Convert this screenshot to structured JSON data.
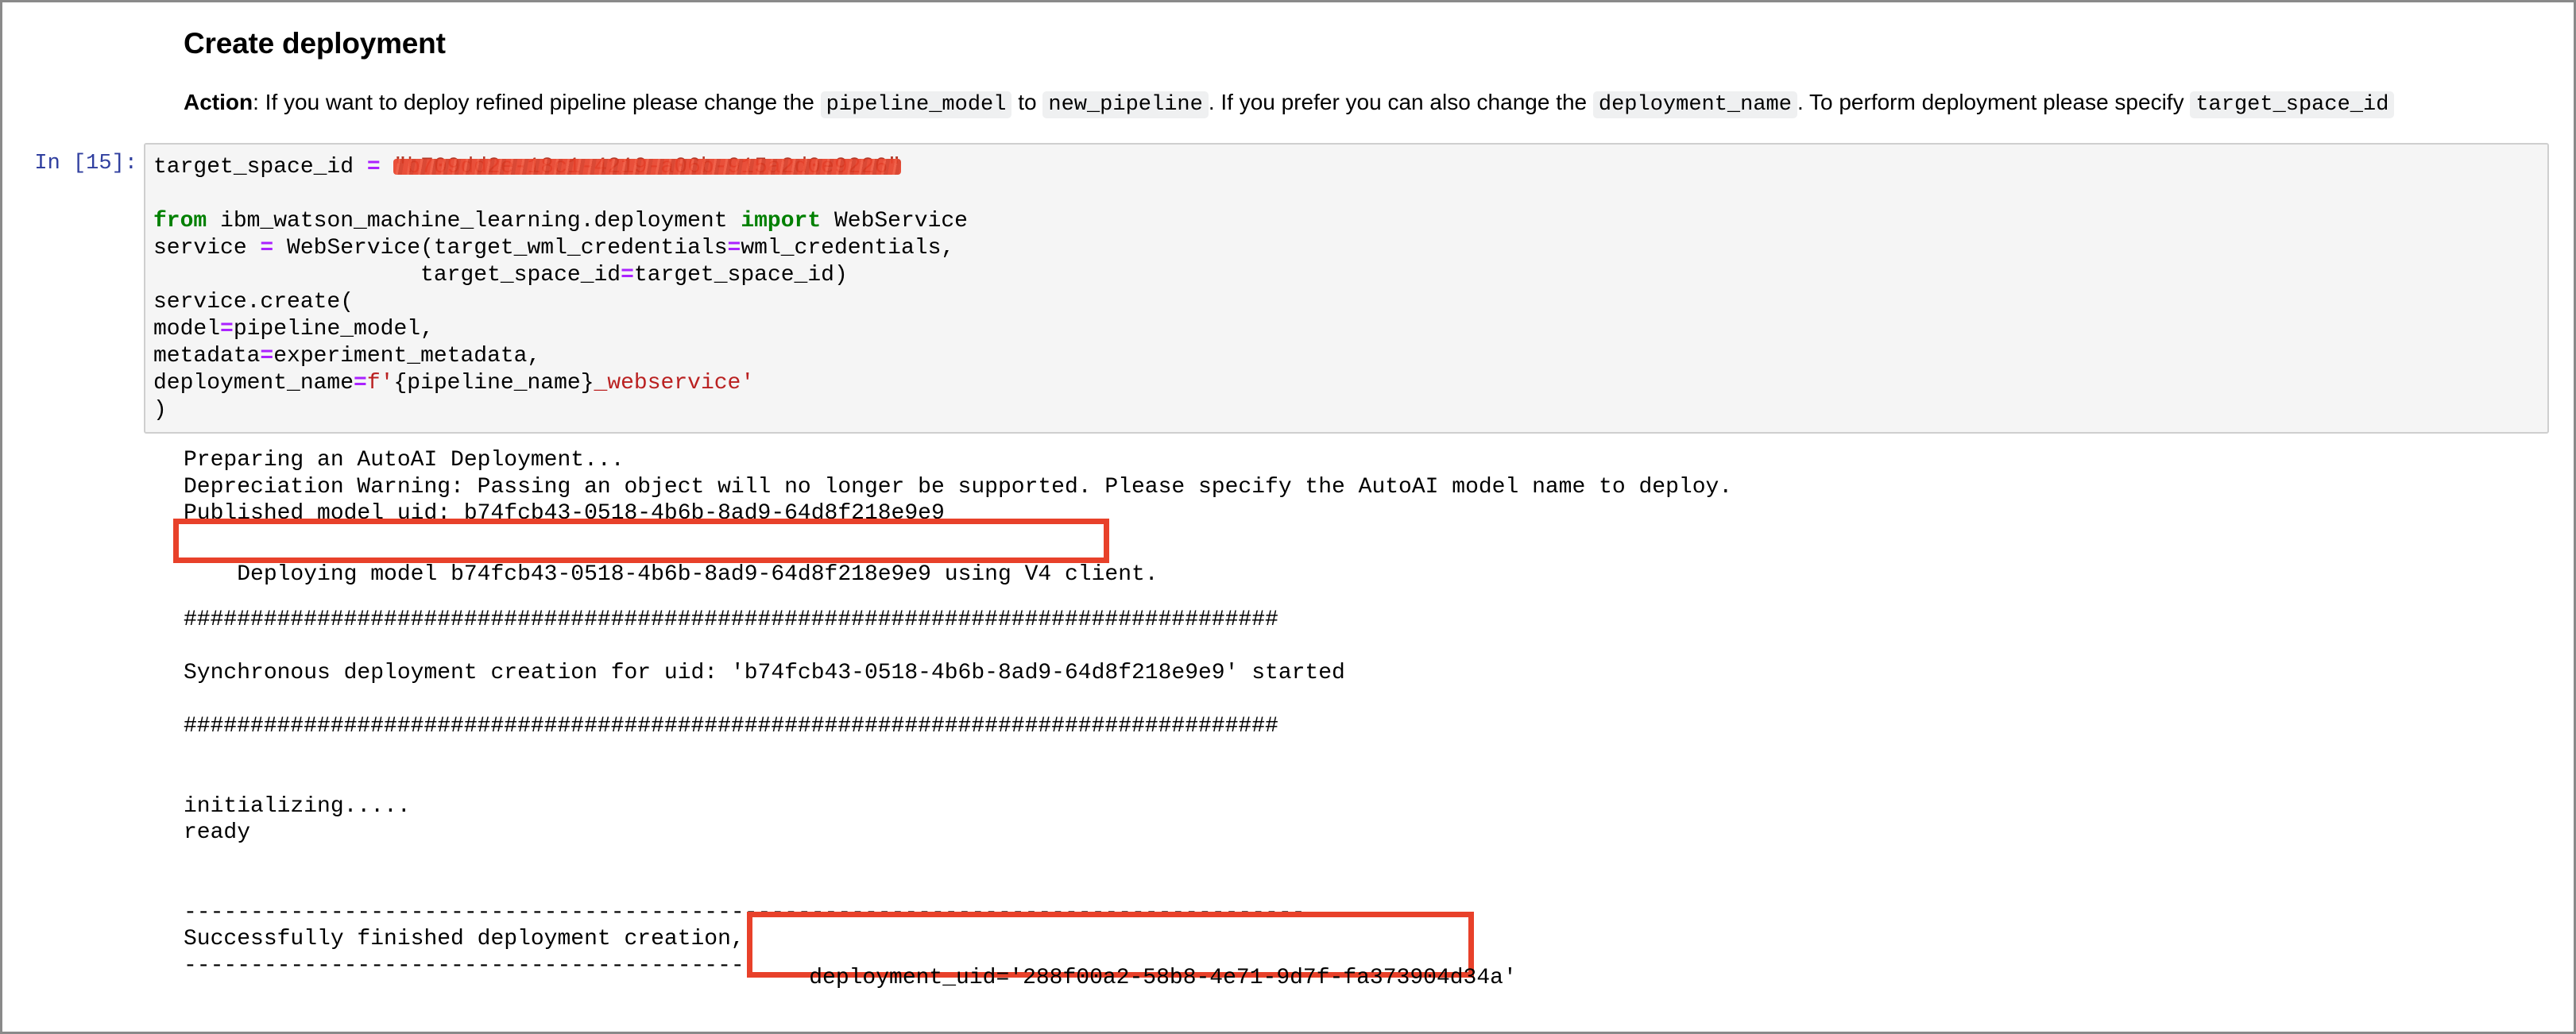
{
  "markdown": {
    "heading": "Create deployment",
    "action_label": "Action",
    "action_parts": [
      {
        "type": "text",
        "value": ": If you want to deploy refined pipeline please change the "
      },
      {
        "type": "code",
        "value": "pipeline_model"
      },
      {
        "type": "text",
        "value": " to "
      },
      {
        "type": "code",
        "value": "new_pipeline"
      },
      {
        "type": "text",
        "value": ". If you prefer you can also change the "
      },
      {
        "type": "code",
        "value": "deployment_name"
      },
      {
        "type": "text",
        "value": ". To perform deployment please specify "
      },
      {
        "type": "code",
        "value": "target_space_id"
      }
    ]
  },
  "cell": {
    "prompt": "In [15]:",
    "code_lines": [
      [
        {
          "t": "target_space_id "
        },
        {
          "t": "=",
          "c": "op"
        },
        {
          "t": " "
        },
        {
          "t": "\"b709dd2e-18c1-4219-a06b-915a2d0e9226\"",
          "c": "str",
          "redacted": true
        }
      ],
      [
        {
          "t": ""
        }
      ],
      [
        {
          "t": "from",
          "c": "kw"
        },
        {
          "t": " ibm_watson_machine_learning.deployment "
        },
        {
          "t": "import",
          "c": "kw"
        },
        {
          "t": " WebService"
        }
      ],
      [
        {
          "t": "service "
        },
        {
          "t": "=",
          "c": "op"
        },
        {
          "t": " WebService(target_wml_credentials"
        },
        {
          "t": "=",
          "c": "op"
        },
        {
          "t": "wml_credentials,"
        }
      ],
      [
        {
          "t": "                    target_space_id"
        },
        {
          "t": "=",
          "c": "op"
        },
        {
          "t": "target_space_id)"
        }
      ],
      [
        {
          "t": "service.create("
        }
      ],
      [
        {
          "t": "model"
        },
        {
          "t": "=",
          "c": "op"
        },
        {
          "t": "pipeline_model,"
        }
      ],
      [
        {
          "t": "metadata"
        },
        {
          "t": "=",
          "c": "op"
        },
        {
          "t": "experiment_metadata,"
        }
      ],
      [
        {
          "t": "deployment_name"
        },
        {
          "t": "=",
          "c": "op"
        },
        {
          "t": "f'",
          "c": "str"
        },
        {
          "t": "{pipeline_name}"
        },
        {
          "t": "_webservice'",
          "c": "str"
        }
      ],
      [
        {
          "t": ")"
        }
      ]
    ]
  },
  "output": {
    "lines": [
      "Preparing an AutoAI Deployment...",
      "Depreciation Warning: Passing an object will no longer be supported. Please specify the AutoAI model name to deploy.",
      "Published model uid: b74fcb43-0518-4b6b-8ad9-64d8f218e9e9",
      "Deploying model b74fcb43-0518-4b6b-8ad9-64d8f218e9e9 using V4 client.",
      "",
      "",
      "##################################################################################",
      "",
      "Synchronous deployment creation for uid: 'b74fcb43-0518-4b6b-8ad9-64d8f218e9e9' started",
      "",
      "##################################################################################",
      "",
      "",
      "initializing.....",
      "ready",
      "",
      "",
      "------------------------------------------------------------------------------------",
      "Successfully finished deployment creation, deployment_uid='288f00a2-58b8-4e71-9d7f-fa373904d34a'",
      "------------------------------------------------------------------------------------"
    ],
    "highlight_deploying": "Deploying model b74fcb43-0518-4b6b-8ad9-64d8f218e9e9 using V4 client.",
    "highlight_deployment_uid": "deployment_uid='288f00a2-58b8-4e71-9d7f-fa373904d34a'"
  },
  "colors": {
    "highlight_border": "#e8412a",
    "prompt": "#303f9f",
    "keyword": "#008000",
    "operator": "#aa22ff",
    "string": "#ba2121"
  }
}
